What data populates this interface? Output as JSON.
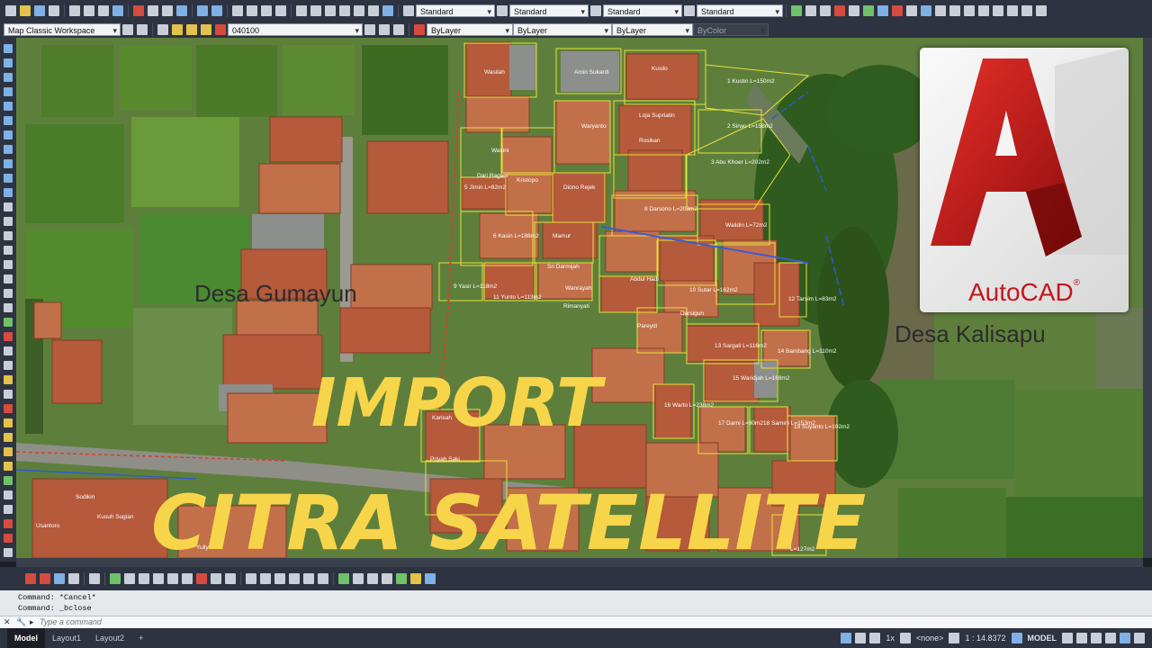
{
  "toolbar": {
    "text_style": "Standard",
    "dim_style": "Standard",
    "table_style": "Standard",
    "mleader_style": "Standard"
  },
  "workspace": "Map Classic Workspace",
  "layer": "040100",
  "color": "ByLayer",
  "linetype": "ByLayer",
  "lineweight": "ByLayer",
  "plotstyle": "ByColor",
  "canvas": {
    "village_left": "Desa Gumayun",
    "village_right": "Desa Kalisapu",
    "title_line1": "IMPORT",
    "title_line2": "CITRA SATELLITE",
    "parcels": [
      {
        "label": "Kusilo"
      },
      {
        "label": "Amin Sukardi"
      },
      {
        "label": "Wasilah"
      },
      {
        "label": "1 Kustin L=150m2"
      },
      {
        "label": "Loja Supriatin"
      },
      {
        "label": "Waryanto"
      },
      {
        "label": "2 Sirwo L=158m2"
      },
      {
        "label": "Rosikan"
      },
      {
        "label": "3 Abu Khoer L=202m2"
      },
      {
        "label": "Wasini"
      },
      {
        "label": "Dari Ragani"
      },
      {
        "label": "5 Jimin L=82m2"
      },
      {
        "label": "Kristopo"
      },
      {
        "label": "Diono Rejek"
      },
      {
        "label": "8 Darsono L=203m2"
      },
      {
        "label": "Walidin L=72m2"
      },
      {
        "label": "6 Kasin L=188m2"
      },
      {
        "label": "Mamur"
      },
      {
        "label": "Sri Darmijah"
      },
      {
        "label": "Wanrayah"
      },
      {
        "label": "9 Yasir L=118m2"
      },
      {
        "label": "11 Yunto L=113m2"
      },
      {
        "label": "Rimanyati"
      },
      {
        "label": "Abdul Hadi"
      },
      {
        "label": "10 Sutar L=162m2"
      },
      {
        "label": "Darsigun"
      },
      {
        "label": "12 Tarsim L=83m2"
      },
      {
        "label": "Pareydi"
      },
      {
        "label": "13 Sargali L=116m2"
      },
      {
        "label": "14 Bambang L=110m2"
      },
      {
        "label": "15 Waridjah L=168m2"
      },
      {
        "label": "16 Warto L=238m2"
      },
      {
        "label": "Karisah"
      },
      {
        "label": "17 Darni L=90m2"
      },
      {
        "label": "18 Samini L=153m2"
      },
      {
        "label": "19 Suyanto L=102m2"
      },
      {
        "label": "Priyah Saki"
      },
      {
        "label": "L=127m2"
      },
      {
        "label": "Sodikin"
      },
      {
        "label": "Kusuh Sugian"
      },
      {
        "label": "Usantoro"
      },
      {
        "label": "Yuliyatno"
      }
    ]
  },
  "logo": {
    "text": "AutoCAD",
    "reg": "®"
  },
  "command": {
    "line1": "Command: *Cancel*",
    "line2": "Command: _bclose",
    "placeholder": "Type a command"
  },
  "tabs": [
    "Model",
    "Layout1",
    "Layout2"
  ],
  "add_tab": "+",
  "status": {
    "scale_annot": "1x",
    "viewport": "<none>",
    "scale": "1 : 14.8372",
    "space": "MODEL"
  }
}
